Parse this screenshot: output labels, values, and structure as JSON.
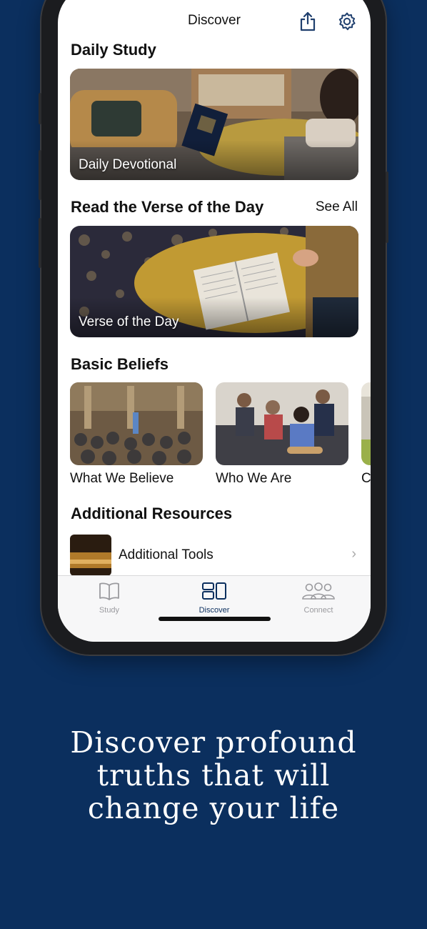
{
  "nav": {
    "title": "Discover"
  },
  "daily_study": {
    "title": "Daily Study",
    "card_label": "Daily Devotional"
  },
  "verse": {
    "title": "Read the Verse of the Day",
    "see_all": "See All",
    "card_label": "Verse of the Day"
  },
  "beliefs": {
    "title": "Basic Beliefs",
    "items": [
      {
        "label": "What We Believe"
      },
      {
        "label": "Who We Are"
      },
      {
        "label": "C"
      }
    ]
  },
  "resources": {
    "title": "Additional Resources",
    "items": [
      {
        "label": "Additional Tools"
      }
    ]
  },
  "tabs": [
    {
      "label": "Study",
      "icon": "book-icon",
      "active": false
    },
    {
      "label": "Discover",
      "icon": "discover-icon",
      "active": true
    },
    {
      "label": "Connect",
      "icon": "people-icon",
      "active": false
    }
  ],
  "headline": [
    "Discover profound",
    "truths that will",
    "change your life"
  ],
  "colors": {
    "background": "#0b2f5e",
    "accent": "#0b2f5e",
    "tab_inactive": "#9a9a9e"
  }
}
